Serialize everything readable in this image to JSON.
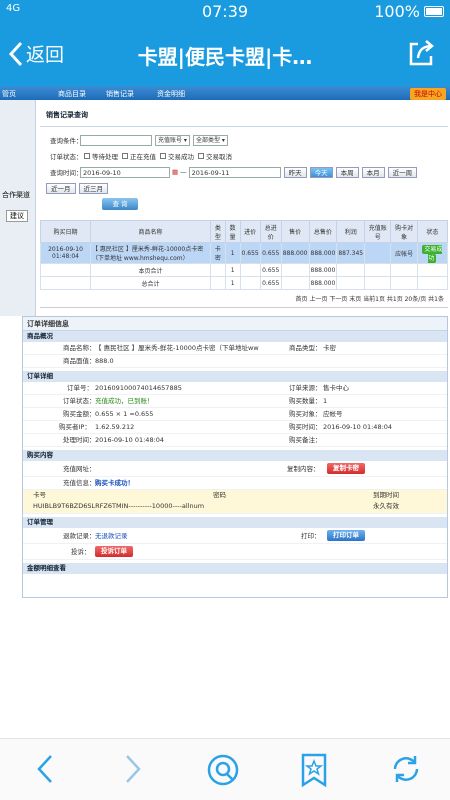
{
  "status_bar": {
    "signal": "4G",
    "time": "07:39",
    "battery": "100%"
  },
  "nav": {
    "back_label": "返回",
    "title": "卡盟|便民卡盟|卡…"
  },
  "topnav": {
    "items": [
      "管页",
      "商品目录",
      "销售记录",
      "资金明细"
    ],
    "vip": "我是中心"
  },
  "left": {
    "labels": [
      "合作渠道",
      "建议"
    ]
  },
  "query": {
    "heading": "销售记录查询",
    "cond_label": "查询条件：",
    "cond_value": "",
    "select1": "充值账号",
    "select2": "全部类型",
    "status_label": "订单状态：",
    "opts": [
      "等待处理",
      "正在充值",
      "交易成功",
      "交易取消"
    ],
    "time_label": "查询时间：",
    "date_from": "2016-09-10",
    "date_to": "2016-09-11",
    "quick": [
      "昨天",
      "今天",
      "本周",
      "本月",
      "近一周",
      "近一月",
      "近三月"
    ],
    "search": "查 询"
  },
  "table": {
    "headers": [
      "购买日期",
      "商品名称",
      "类型",
      "数量",
      "进价",
      "总进价",
      "售价",
      "总售价",
      "利润",
      "充值账号",
      "购卡对象",
      "状态"
    ],
    "row": {
      "date": "2016-09-10 01:48:04",
      "name": "【 惠民社区 】厘米秀-鲜花-10000点卡密（下单地址 www.hmshequ.com）",
      "type": "卡密",
      "qty": "1",
      "price": "0.655",
      "total": "0.655",
      "sell": "888.000",
      "total_sell": "888.000",
      "profit": "887.345",
      "account": "",
      "target": "应帐号",
      "status": "交易成功"
    },
    "page_total_label": "本页合计",
    "page_total": {
      "qty": "1",
      "total": "0.655",
      "sell": "888.000"
    },
    "sum_label": "总合计",
    "sum": {
      "qty": "1",
      "total": "0.655",
      "sell": "888.000"
    },
    "pager": "首页 上一页 下一页 末页 当前1页 共1页 20条/页 共1条"
  },
  "detail": {
    "title": "订单详细信息",
    "goods_section": "商品概况",
    "goods_name_label": "商品名称：",
    "goods_name": "【 惠民社区 】厘米秀-鲜花-10000点卡密（下单地址ww",
    "goods_type_label": "商品类型：",
    "goods_type": "卡密",
    "goods_price_label": "商品面值：",
    "goods_price": "888.0",
    "order_section": "订单详细",
    "order_no_label": "订单号：",
    "order_no": "201609100074014657885",
    "source_label": "订单来源：",
    "source": "售卡中心",
    "ostatus_label": "订单状态：",
    "ostatus": "充值成功，已到账！",
    "buy_qty_label": "购买数量：",
    "buy_qty": "1",
    "buy_amt_label": "购买金额：",
    "buy_amt": "0.655 × 1 =0.655",
    "buy_obj_label": "购买对象：",
    "buy_obj": "应帐号",
    "ip_label": "购买者IP：",
    "ip": "1.62.59.212",
    "buy_time_label": "购买时间：",
    "buy_time": "2016-09-10 01:48:04",
    "handle_time_label": "处理时间：",
    "handle_time": "2016-09-10 01:48:04",
    "remark_label": "购买备注：",
    "remark": "",
    "content_section": "购买内容",
    "recharge_addr_label": "充值网址：",
    "copy_label": "复制内容：",
    "copy_btn": "复制卡密",
    "recharge_info_label": "充值信息：",
    "recharge_info": "购买卡成功！",
    "card_header": [
      "卡号",
      "密码",
      "到期时间"
    ],
    "card_row": [
      "HUIBLB9T6BZD6SLRFZ6TMIN----------10000----allnum",
      "",
      "永久有效"
    ],
    "manage_section": "订单管理",
    "refund_label": "退款记录：",
    "refund_value": "无退款记录",
    "print_label": "打印：",
    "print_btn": "打印订单",
    "complain_label": "投诉：",
    "complain_btn": "投诉订单",
    "funds_section": "金额明细查看"
  }
}
